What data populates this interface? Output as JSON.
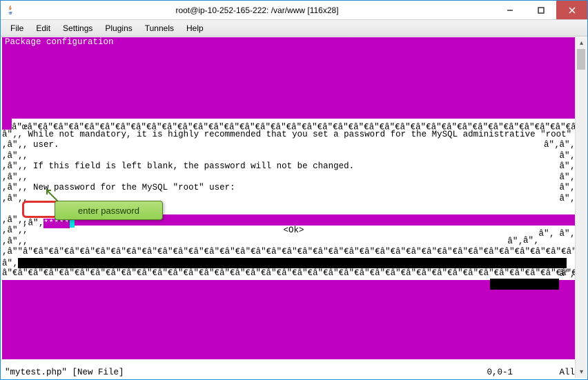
{
  "window": {
    "title": "root@ip-10-252-165-222: /var/www [116x28]"
  },
  "menu": {
    "file": "File",
    "edit": "Edit",
    "settings": "Settings",
    "plugins": "Plugins",
    "tunnels": "Tunnels",
    "help": "Help"
  },
  "terminal": {
    "pkg_header": "Package configuration",
    "border_glyphs_top": "â\"œâ\"€â\"€â\"€â\"€â\"€â\"€â\"€â\"€â\"€â\"€â\"€â\"€â\"€â\"€â\"€â\"€â\"€â\"€â\"€â\"€â\"€â\"€â\"€â\"€â\"€â\"€â\"€â\"€â\"€â\"€â\"€â\"€â\"€â\"€â\"€â\"€â\"€â\"€â\"€â\"€â\"€â\"€â\"€â\"€â\"€",
    "side_glyph": "â\"‚",
    "line1": " While not mandatory, it is highly recommended that you set a password for the MySQL administrative \"root\"",
    "line1b": " user.",
    "line_blank": ",",
    "line2": " If this field is left blank, the password will not be changed.",
    "line3": " New password for the MySQL \"root\" user:",
    "password_masked": "*****",
    "ok_button": "<Ok>",
    "border_glyphs_bottom": "â\"\"â\"€â\"€â\"€â\"€â\"€â\"€â\"€â\"€â\"€â\"€â\"€â\"€â\"€â\"€â\"€â\"€â\"€â\"€â\"€â\"€â\"€â\"€â\"€â\"€â\"€â\"€â\"€â\"€â\"€â\"€â\"€â\"€â\"€â\"€â\"€â\"€â\"€â\"€â\"€â\"€â\"€â\"€â\"€â\"€â\"€",
    "border_glyphs_bottom2": "â\"€â\"€â\"€â\"€â\"€â\"€â\"€â\"€â\"€â\"€â\"€â\"€â\"€â\"€â\"€â\"€â\"€â\"€â\"€â\"€â\"€â\"€â\"€â\"€â\"€â\"€â\"€â\"€â\"€â\"€â\"€â\"€â\"€â\"€â\"€â\"€â\"€",
    "status_left": "\"mytest.php\" [New File]",
    "status_right": "0,0-1         All"
  },
  "callout": {
    "text": "enter password"
  }
}
